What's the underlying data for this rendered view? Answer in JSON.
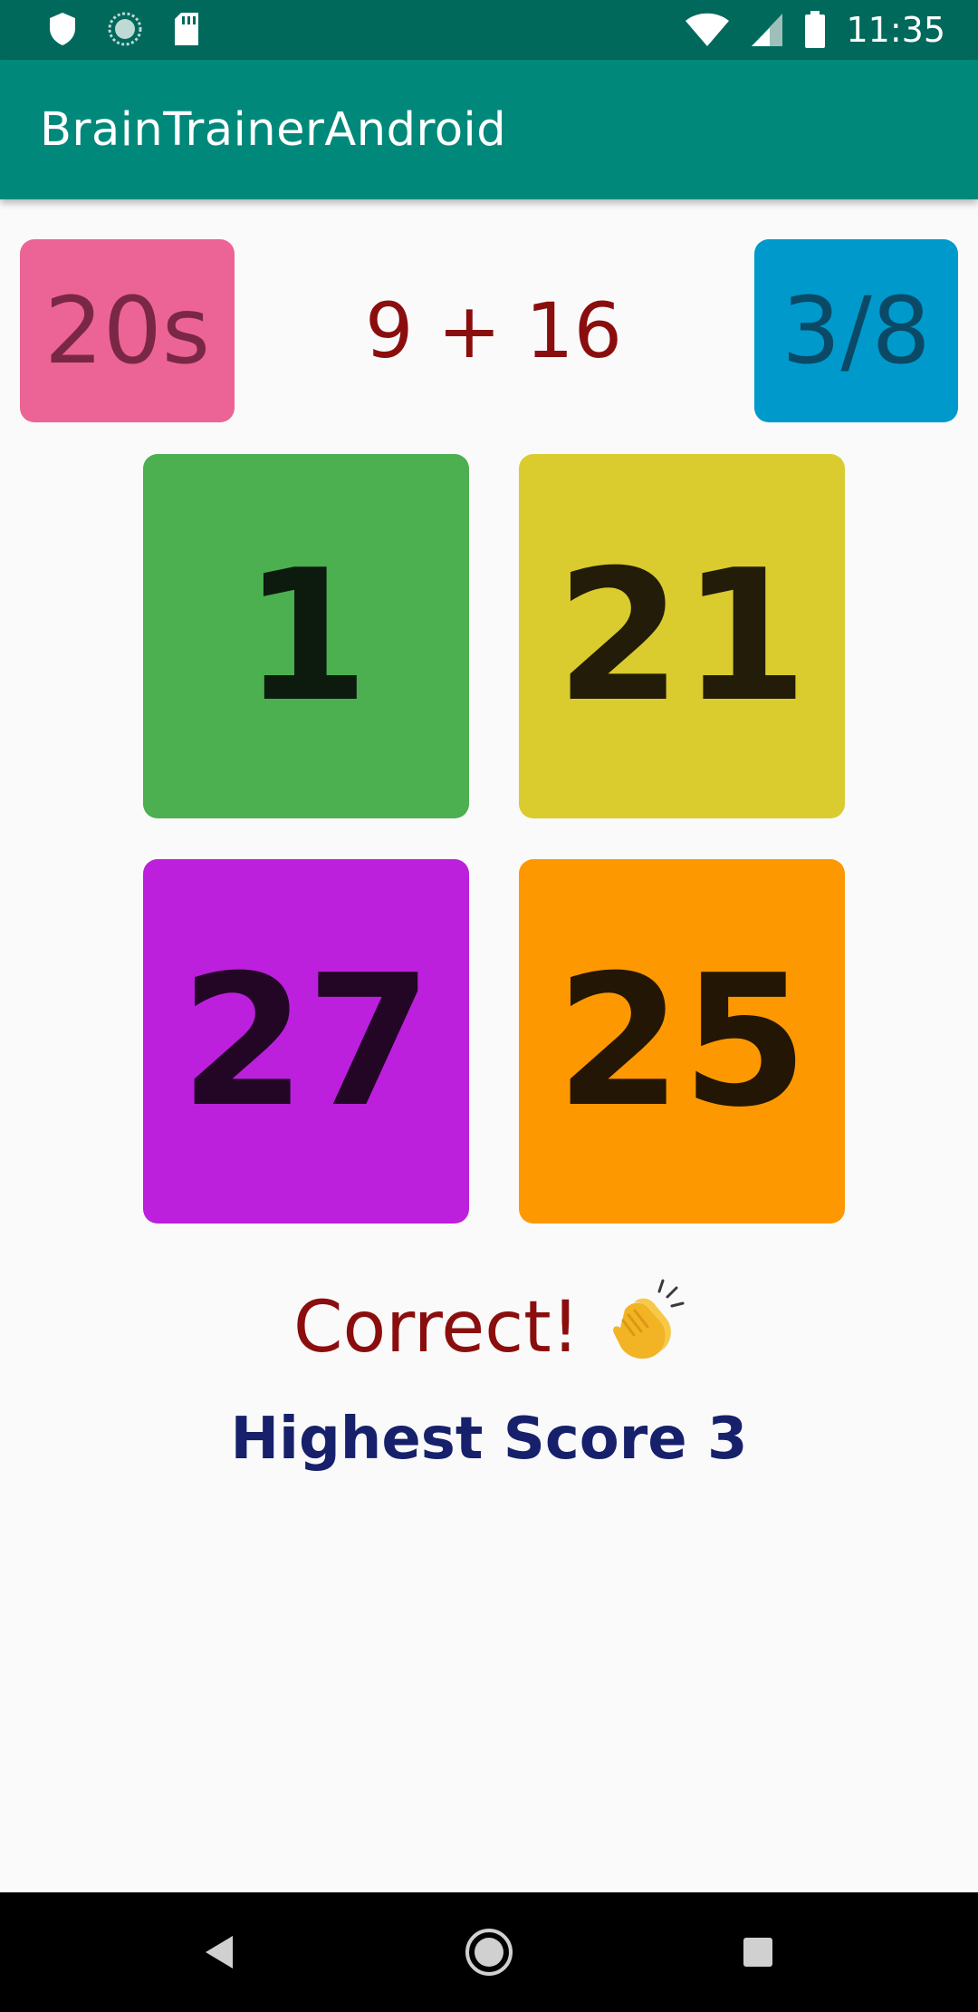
{
  "status_bar": {
    "time": "11:35",
    "left_icons": [
      "shield-icon",
      "sync-icon",
      "sd-card-icon"
    ],
    "right_icons": [
      "wifi-icon",
      "signal-icon",
      "battery-icon"
    ]
  },
  "app_bar": {
    "title": "BrainTrainerAndroid",
    "color": "#00897b"
  },
  "game": {
    "timer": "20s",
    "question": "9 + 16",
    "score": "3/8",
    "answers": [
      {
        "label": "1",
        "color": "#4caf50"
      },
      {
        "label": "21",
        "color": "#dacb2e"
      },
      {
        "label": "27",
        "color": "#bc20dc"
      },
      {
        "label": "25",
        "color": "#fe9800"
      }
    ],
    "result_text": "Correct!",
    "result_icon": "clapping-hands-icon",
    "highest_score": "Highest Score 3"
  },
  "nav_bar": {
    "buttons": [
      "back-icon",
      "home-icon",
      "recents-icon"
    ]
  }
}
